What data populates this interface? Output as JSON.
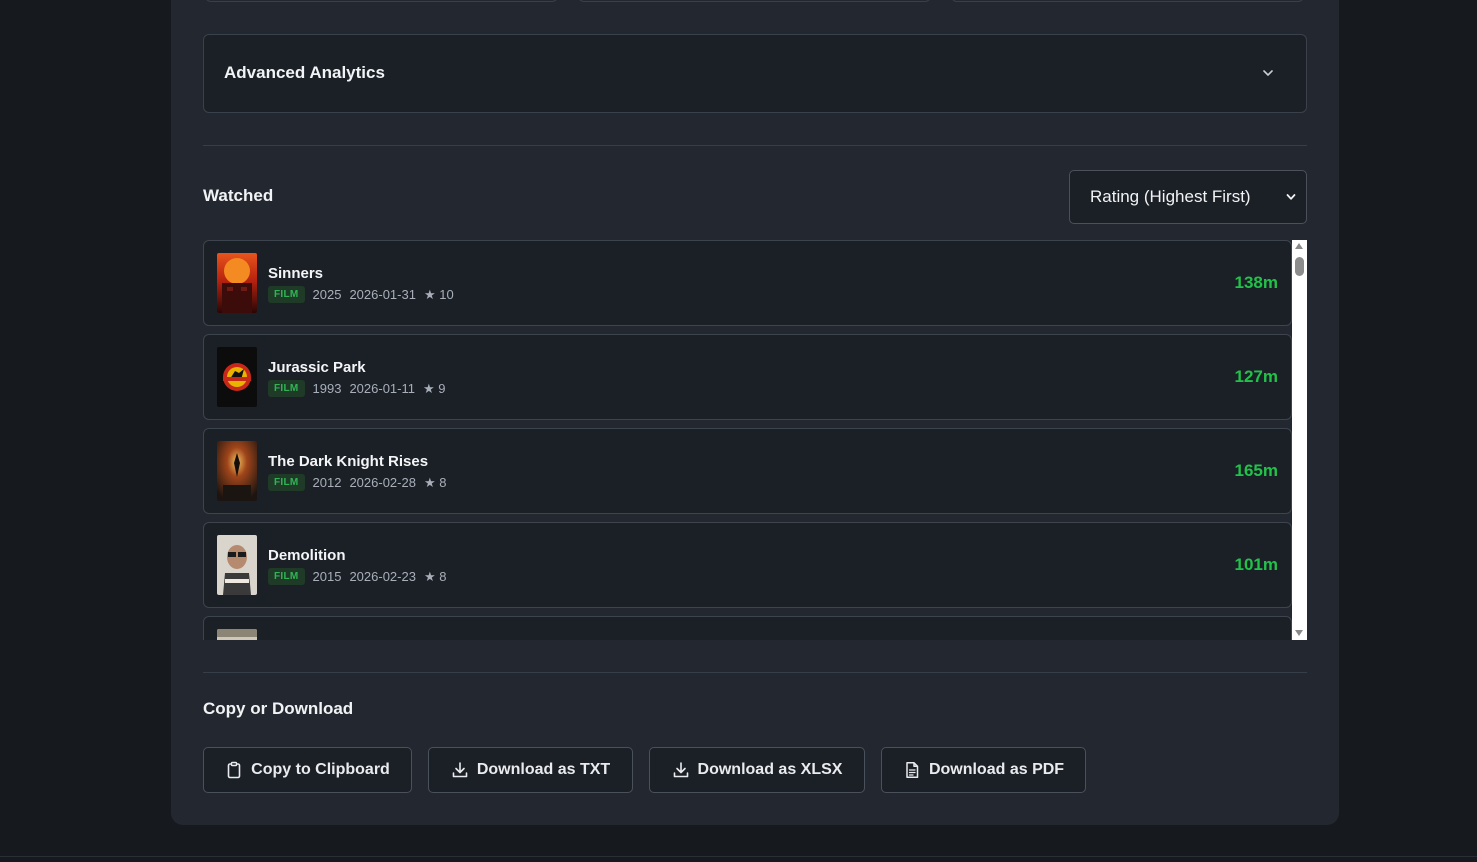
{
  "analytics": {
    "title": "Advanced Analytics",
    "chevron_icon": "chevron-down-icon"
  },
  "watched": {
    "title": "Watched",
    "sort": {
      "selected": "Rating (Highest First)"
    },
    "items": [
      {
        "title": "Sinners",
        "type": "FILM",
        "year": "2025",
        "date": "2026-01-31",
        "rating": "10",
        "duration": "138m"
      },
      {
        "title": "Jurassic Park",
        "type": "FILM",
        "year": "1993",
        "date": "2026-01-11",
        "rating": "9",
        "duration": "127m"
      },
      {
        "title": "The Dark Knight Rises",
        "type": "FILM",
        "year": "2012",
        "date": "2026-02-28",
        "rating": "8",
        "duration": "165m"
      },
      {
        "title": "Demolition",
        "type": "FILM",
        "year": "2015",
        "date": "2026-02-23",
        "rating": "8",
        "duration": "101m"
      }
    ],
    "star_glyph": "★"
  },
  "export": {
    "title": "Copy or Download",
    "buttons": {
      "copy": "Copy to Clipboard",
      "txt": "Download as TXT",
      "xlsx": "Download as XLSX",
      "pdf": "Download as PDF"
    }
  },
  "colors": {
    "accent_green": "#22c24a",
    "badge_bg": "#1f3b28",
    "panel_bg": "#232830",
    "page_bg": "#16191d"
  }
}
